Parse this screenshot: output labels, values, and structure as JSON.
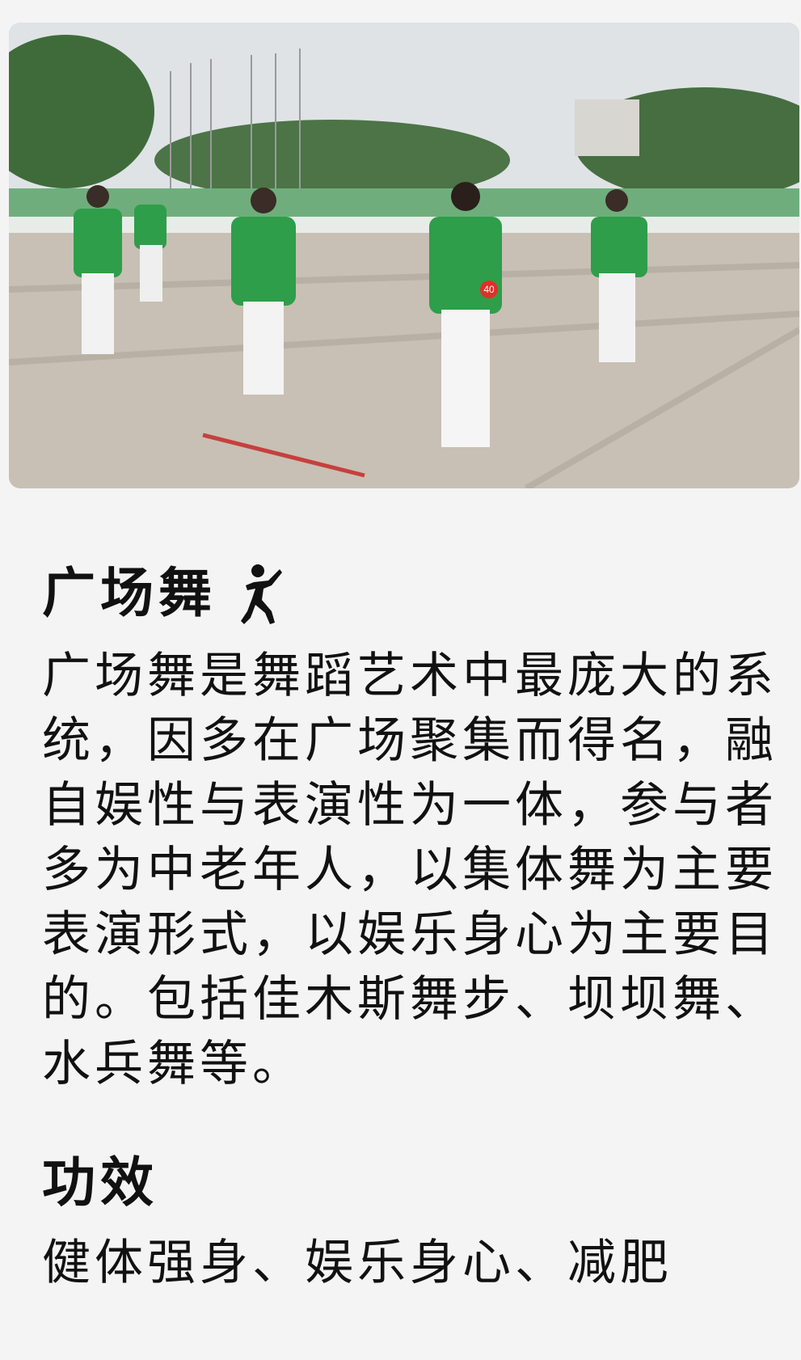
{
  "hero": {
    "image_name": "square-dance-photo",
    "badge_number": "40"
  },
  "intro": {
    "title": "广场舞",
    "title_icon": "dancer-icon",
    "body": "广场舞是舞蹈艺术中最庞大的系统，因多在广场聚集而得名，融自娱性与表演性为一体，参与者多为中老年人，以集体舞为主要表演形式，以娱乐身心为主要目的。包括佳木斯舞步、坝坝舞、水兵舞等。"
  },
  "effects": {
    "title": "功效",
    "body": "健体强身、娱乐身心、减肥"
  },
  "colors": {
    "background": "#f4f4f4",
    "text": "#111111",
    "shirt_green": "#2e9e4a"
  }
}
